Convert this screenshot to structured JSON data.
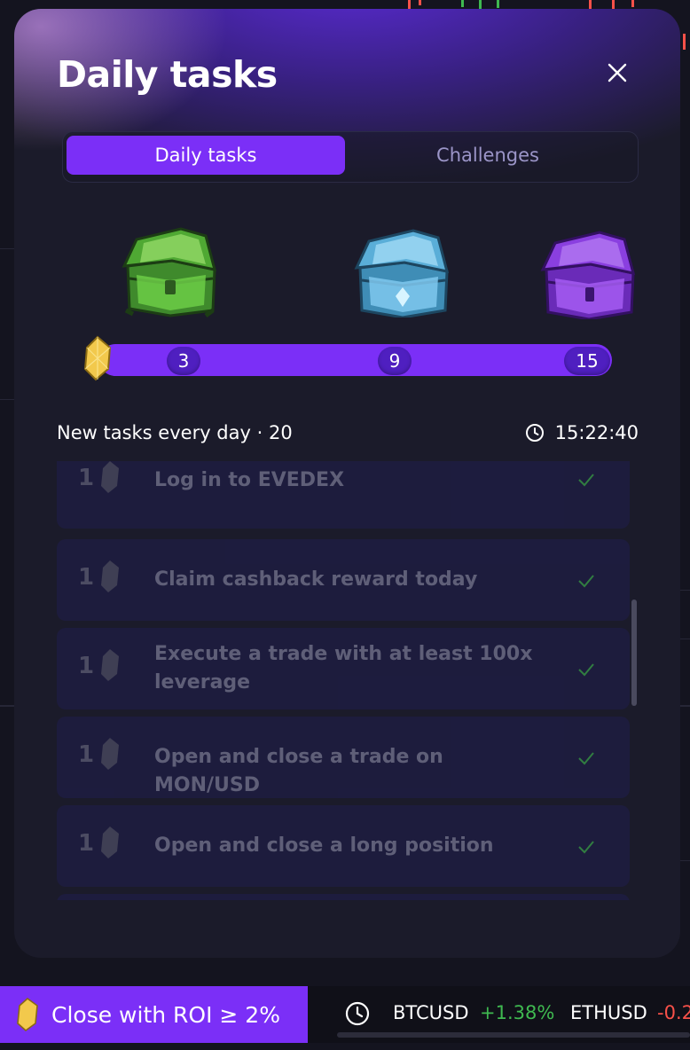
{
  "modal": {
    "title": "Daily tasks",
    "tabs": [
      {
        "label": "Daily tasks",
        "active": true
      },
      {
        "label": "Challenges",
        "active": false
      }
    ]
  },
  "progress": {
    "milestones": [
      "3",
      "9",
      "15"
    ],
    "chests": [
      "green-chest-icon",
      "blue-chest-icon",
      "purple-chest-icon"
    ],
    "fill_color": "#7b2ff7"
  },
  "info": {
    "text": "New tasks every day · 20",
    "timer": "15:22:40"
  },
  "tasks": [
    {
      "reward": "1",
      "label": "Log in to EVEDEX",
      "done": true
    },
    {
      "reward": "1",
      "label": "Claim cashback reward today",
      "done": true
    },
    {
      "reward": "1",
      "label": "Execute a trade with at least 100x leverage",
      "done": true
    },
    {
      "reward": "1",
      "label": "Open and close a trade on MON/USD",
      "done": true
    },
    {
      "reward": "1",
      "label": "Open and close a long position",
      "done": true
    }
  ],
  "ticker": {
    "banner": "Close with ROI ≥ 2%",
    "items": [
      {
        "symbol": "BTCUSD",
        "change": "+1.38%",
        "color": "#3fb950"
      },
      {
        "symbol": "ETHUSD",
        "change": "-0.2",
        "color": "#f85149"
      }
    ]
  },
  "colors": {
    "accent": "#7b2ff7",
    "check": "#3fb950"
  }
}
